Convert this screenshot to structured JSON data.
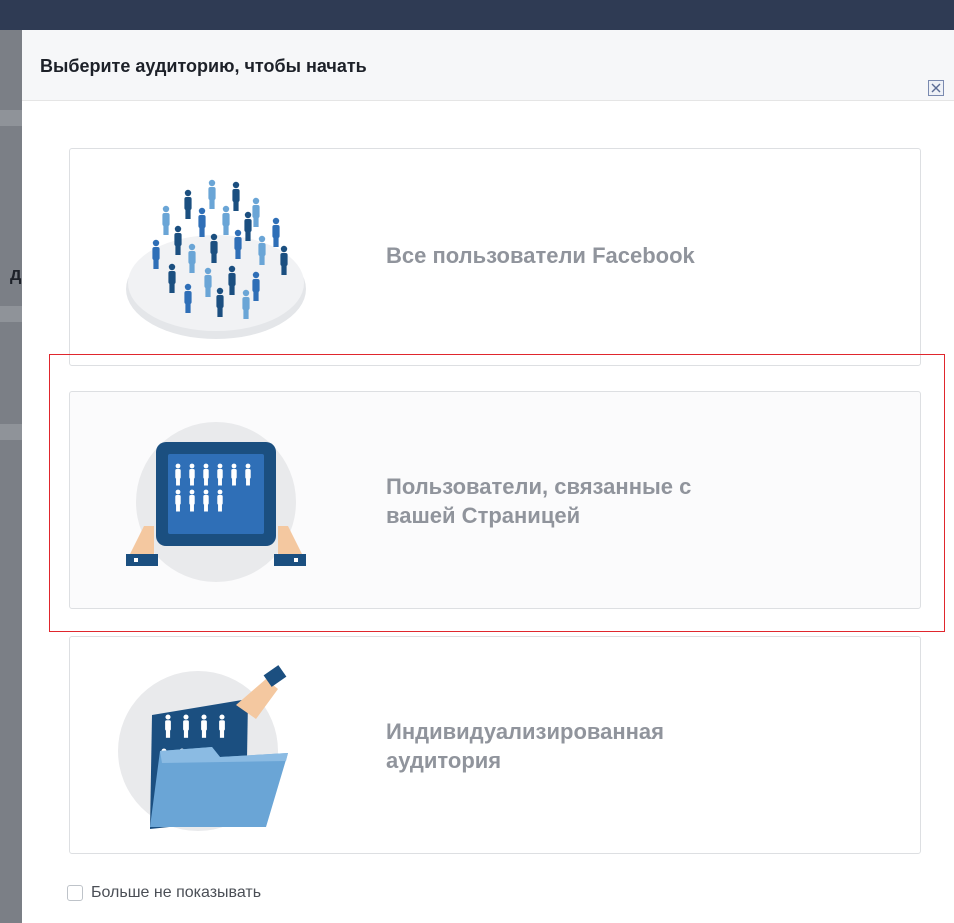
{
  "dialog": {
    "title": "Выберите аудиторию, чтобы начать",
    "close_icon": "close-icon"
  },
  "options": [
    {
      "label": "Все пользователи Facebook",
      "icon": "crowd-icon"
    },
    {
      "label": "Пользователи, связанные с\nвашей Страницей",
      "icon": "tablet-audience-icon",
      "highlighted": true
    },
    {
      "label": "Индивидуализированная\nаудитория",
      "icon": "folder-audience-icon"
    }
  ],
  "footer": {
    "dont_show_label": "Больше не показывать",
    "checked": false
  },
  "background": {
    "left_char": "д"
  },
  "colors": {
    "topbar": "#2f3b54",
    "label": "#90949c",
    "accent_blue": "#2f6fb7",
    "dark_blue": "#1b4f80",
    "light_blue": "#6aa5d6",
    "highlight_outline": "#e0262d"
  }
}
